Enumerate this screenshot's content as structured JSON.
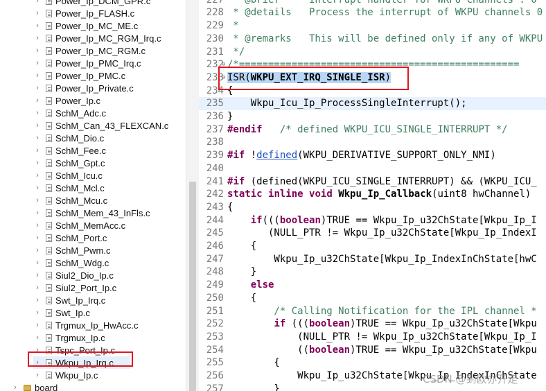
{
  "explorer": {
    "items": [
      {
        "label": "Power_Ip_DCM_GPR.c",
        "type": "file"
      },
      {
        "label": "Power_Ip_FLASH.c",
        "type": "file"
      },
      {
        "label": "Power_Ip_MC_ME.c",
        "type": "file"
      },
      {
        "label": "Power_Ip_MC_RGM_Irq.c",
        "type": "file"
      },
      {
        "label": "Power_Ip_MC_RGM.c",
        "type": "file"
      },
      {
        "label": "Power_Ip_PMC_Irq.c",
        "type": "file"
      },
      {
        "label": "Power_Ip_PMC.c",
        "type": "file"
      },
      {
        "label": "Power_Ip_Private.c",
        "type": "file"
      },
      {
        "label": "Power_Ip.c",
        "type": "file"
      },
      {
        "label": "SchM_Adc.c",
        "type": "file"
      },
      {
        "label": "SchM_Can_43_FLEXCAN.c",
        "type": "file"
      },
      {
        "label": "SchM_Dio.c",
        "type": "file"
      },
      {
        "label": "SchM_Fee.c",
        "type": "file"
      },
      {
        "label": "SchM_Gpt.c",
        "type": "file"
      },
      {
        "label": "SchM_Icu.c",
        "type": "file"
      },
      {
        "label": "SchM_Mcl.c",
        "type": "file"
      },
      {
        "label": "SchM_Mcu.c",
        "type": "file"
      },
      {
        "label": "SchM_Mem_43_InFls.c",
        "type": "file"
      },
      {
        "label": "SchM_MemAcc.c",
        "type": "file"
      },
      {
        "label": "SchM_Port.c",
        "type": "file"
      },
      {
        "label": "SchM_Pwm.c",
        "type": "file"
      },
      {
        "label": "SchM_Wdg.c",
        "type": "file"
      },
      {
        "label": "Siul2_Dio_Ip.c",
        "type": "file"
      },
      {
        "label": "Siul2_Port_Ip.c",
        "type": "file"
      },
      {
        "label": "Swt_Ip_Irq.c",
        "type": "file"
      },
      {
        "label": "Swt_Ip.c",
        "type": "file"
      },
      {
        "label": "Trgmux_Ip_HwAcc.c",
        "type": "file"
      },
      {
        "label": "Trgmux_Ip.c",
        "type": "file"
      },
      {
        "label": "Tspc_Port_Ip.c",
        "type": "file"
      },
      {
        "label": "Wkpu_Ip_Irq.c",
        "type": "file",
        "selected": true
      },
      {
        "label": "Wkpu_Ip.c",
        "type": "file"
      },
      {
        "label": "board",
        "type": "folder"
      }
    ]
  },
  "editor": {
    "lines": [
      {
        "n": "227",
        "text": " * @brief     Interrupt handler for WKPU channels : 0"
      },
      {
        "n": "228",
        "text": " * @details   Process the interrupt of WKPU channels 0"
      },
      {
        "n": "229",
        "text": " *"
      },
      {
        "n": "230",
        "text": " * @remarks   This will be defined only if any of WKPU"
      },
      {
        "n": "231",
        "text": " */"
      },
      {
        "n": "232",
        "text": "/*================================================"
      },
      {
        "n": "233",
        "text": "ISR(WKPU_EXT_IRQ_SINGLE_ISR)"
      },
      {
        "n": "234",
        "text": "{"
      },
      {
        "n": "235",
        "text": "    Wkpu_Icu_Ip_ProcessSingleInterrupt();"
      },
      {
        "n": "236",
        "text": "}"
      },
      {
        "n": "237",
        "text": "#endif   /* defined WKPU_ICU_SINGLE_INTERRUPT */"
      },
      {
        "n": "238",
        "text": ""
      },
      {
        "n": "239",
        "text": "#if !defined(WKPU_DERIVATIVE_SUPPORT_ONLY_NMI)"
      },
      {
        "n": "240",
        "text": ""
      },
      {
        "n": "241",
        "text": "#if (defined(WKPU_ICU_SINGLE_INTERRUPT) && (WKPU_ICU_"
      },
      {
        "n": "242",
        "text": "static inline void Wkpu_Ip_Callback(uint8 hwChannel)"
      },
      {
        "n": "243",
        "text": "{"
      },
      {
        "n": "244",
        "text": "    if(((boolean)TRUE == Wkpu_Ip_u32ChState[Wkpu_Ip_I"
      },
      {
        "n": "245",
        "text": "       (NULL_PTR != Wkpu_Ip_u32ChState[Wkpu_Ip_IndexI"
      },
      {
        "n": "246",
        "text": "    {"
      },
      {
        "n": "247",
        "text": "        Wkpu_Ip_u32ChState[Wkpu_Ip_IndexInChState[hwC"
      },
      {
        "n": "248",
        "text": "    }"
      },
      {
        "n": "249",
        "text": "    else"
      },
      {
        "n": "250",
        "text": "    {"
      },
      {
        "n": "251",
        "text": "        /* Calling Notification for the IPL channel *"
      },
      {
        "n": "252",
        "text": "        if (((boolean)TRUE == Wkpu_Ip_u32ChState[Wkpu"
      },
      {
        "n": "253",
        "text": "            (NULL_PTR != Wkpu_Ip_u32ChState[Wkpu_Ip_I"
      },
      {
        "n": "254",
        "text": "            ((boolean)TRUE == Wkpu_Ip_u32ChState[Wkpu"
      },
      {
        "n": "255",
        "text": "        {"
      },
      {
        "n": "256",
        "text": "            Wkpu_Ip_u32ChState[Wkpu_Ip_IndexInChState"
      },
      {
        "n": "257",
        "text": "        }"
      }
    ]
  },
  "watermark": "CSDN @到欧亦开走"
}
